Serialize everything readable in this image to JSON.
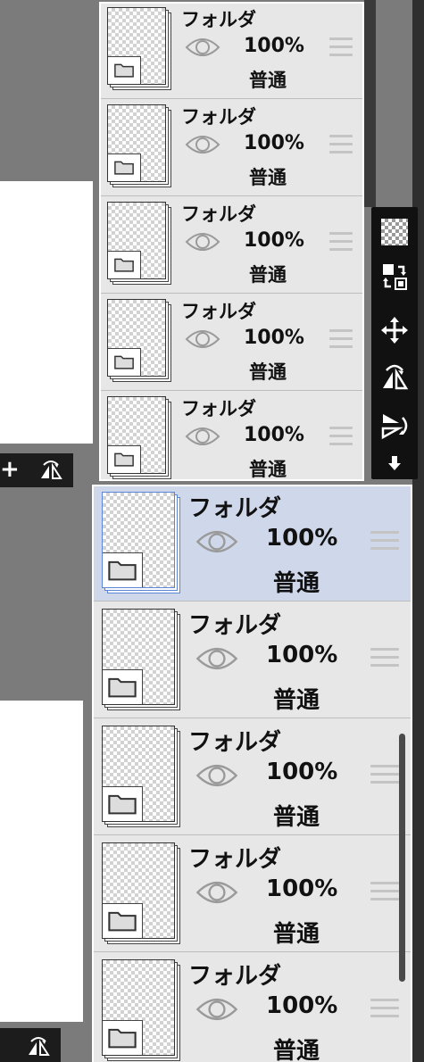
{
  "layer_panel_top": {
    "layers": [
      {
        "name": "フォルダ",
        "opacity": "100%",
        "blend": "普通",
        "thumb_icon": "folder-icon"
      },
      {
        "name": "フォルダ",
        "opacity": "100%",
        "blend": "普通",
        "thumb_icon": "folder-icon"
      },
      {
        "name": "フォルダ",
        "opacity": "100%",
        "blend": "普通",
        "thumb_icon": "folder-icon"
      },
      {
        "name": "フォルダ",
        "opacity": "100%",
        "blend": "普通",
        "thumb_icon": "folder-icon"
      },
      {
        "name": "フォルダ",
        "opacity": "100%",
        "blend": "普通",
        "thumb_icon": "folder-icon"
      }
    ]
  },
  "layer_panel_bottom": {
    "selected_index": 0,
    "layers": [
      {
        "name": "フォルダ",
        "opacity": "100%",
        "blend": "普通",
        "thumb_icon": "folder-icon"
      },
      {
        "name": "フォルダ",
        "opacity": "100%",
        "blend": "普通",
        "thumb_icon": "folder-icon"
      },
      {
        "name": "フォルダ",
        "opacity": "100%",
        "blend": "普通",
        "thumb_icon": "folder-icon"
      },
      {
        "name": "フォルダ",
        "opacity": "100%",
        "blend": "普通",
        "thumb_icon": "folder-icon"
      },
      {
        "name": "フォルダ",
        "opacity": "100%",
        "blend": "普通",
        "thumb_icon": "folder-icon"
      }
    ]
  },
  "side_toolbar": {
    "tools": [
      "transparency-checker-icon",
      "layer-swap-icon",
      "move-icon",
      "flip-horizontal-icon",
      "flip-vertical-icon",
      "move-down-icon"
    ]
  },
  "colors": {
    "background": "#7b7b7b",
    "panel": "#e7e7e7",
    "selected_row": "#cfd8ea",
    "selected_border": "#5b86d6",
    "toolbar": "#111111"
  }
}
